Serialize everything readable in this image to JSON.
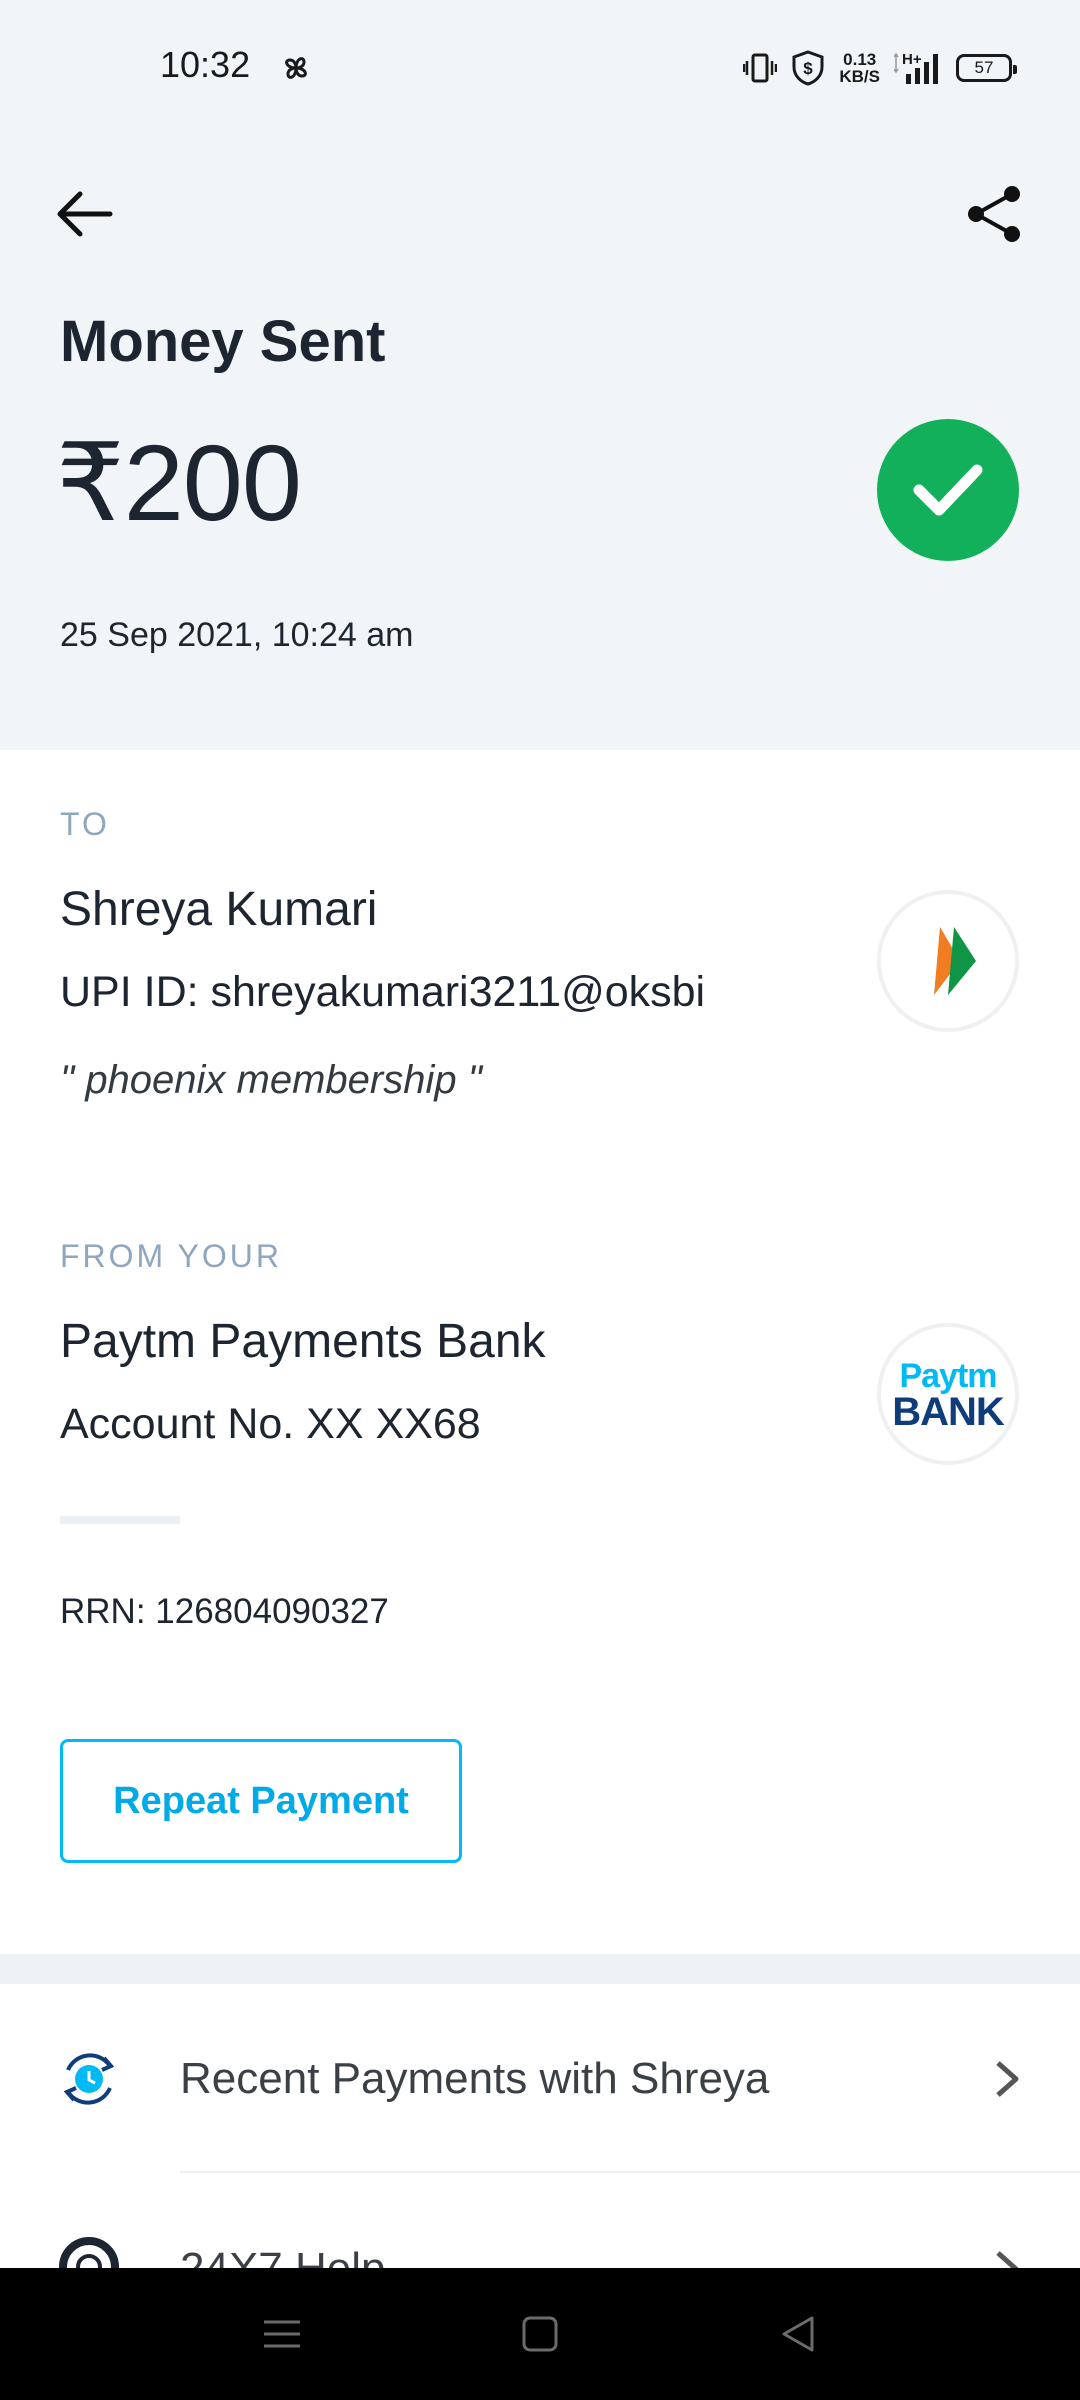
{
  "status_bar": {
    "time": "10:32",
    "net_speed_value": "0.13",
    "net_speed_unit": "KB/S",
    "network_type": "H+",
    "battery": "57"
  },
  "header": {
    "title": "Money Sent",
    "amount": "₹200",
    "datetime": "25 Sep 2021, 10:24 am",
    "status_color": "#12b05a"
  },
  "to": {
    "label": "TO",
    "name": "Shreya Kumari",
    "upi_id": "UPI ID: shreyakumari3211@oksbi",
    "note": "\" phoenix membership \""
  },
  "from": {
    "label": "FROM YOUR",
    "bank_name": "Paytm Payments Bank",
    "account": "Account No. XX XX68",
    "logo_top": "Paytm",
    "logo_bottom": "BANK"
  },
  "rrn": "RRN: 126804090327",
  "actions": {
    "repeat_payment": "Repeat Payment"
  },
  "list": [
    {
      "label": "Recent Payments with Shreya",
      "icon": "recent-payments-icon"
    },
    {
      "label": "24X7 Help",
      "icon": "help-lifebuoy-icon"
    }
  ],
  "colors": {
    "accent": "#00b9f5",
    "header_bg": "#f2f5f7",
    "section_label": "#8ea6bf"
  }
}
